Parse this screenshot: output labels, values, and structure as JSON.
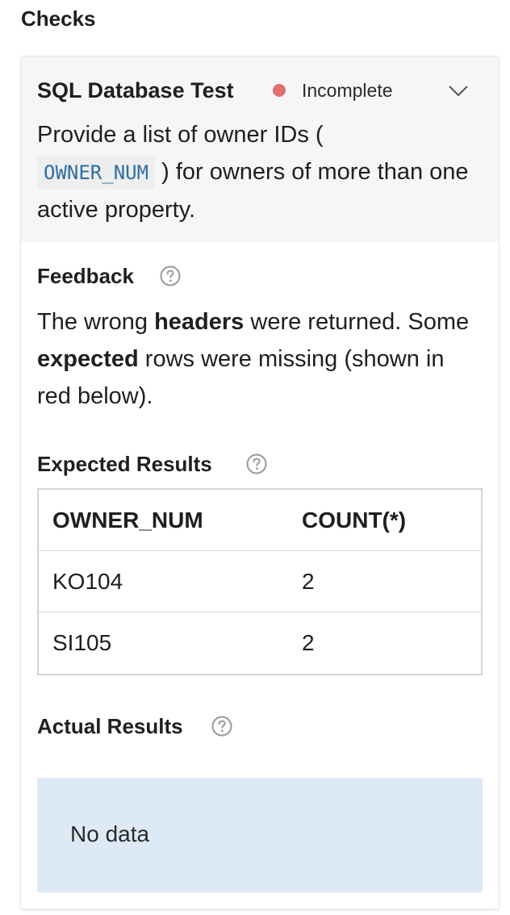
{
  "section_title": "Checks",
  "check": {
    "title": "SQL Database Test",
    "status": "Incomplete",
    "status_color": "#e07070",
    "prompt_before": "Provide a list of owner IDs (",
    "prompt_code": "OWNER_NUM",
    "prompt_after": ") for owners of more than one active property.",
    "toggle_icon": "chevron-down-icon"
  },
  "feedback": {
    "heading": "Feedback",
    "part1": "The wrong ",
    "bold1": "headers",
    "part2": " were returned. Some ",
    "bold2": "expected",
    "part3": " rows were missing (shown in red below)."
  },
  "expected_results": {
    "heading": "Expected Results",
    "columns": [
      "OWNER_NUM",
      "COUNT(*)"
    ],
    "rows": [
      [
        "KO104",
        "2"
      ],
      [
        "SI105",
        "2"
      ]
    ]
  },
  "actual_results": {
    "heading": "Actual Results",
    "empty_message": "No data",
    "empty_bg_color": "#dde9f5"
  },
  "help_icon": "help-circle-icon"
}
